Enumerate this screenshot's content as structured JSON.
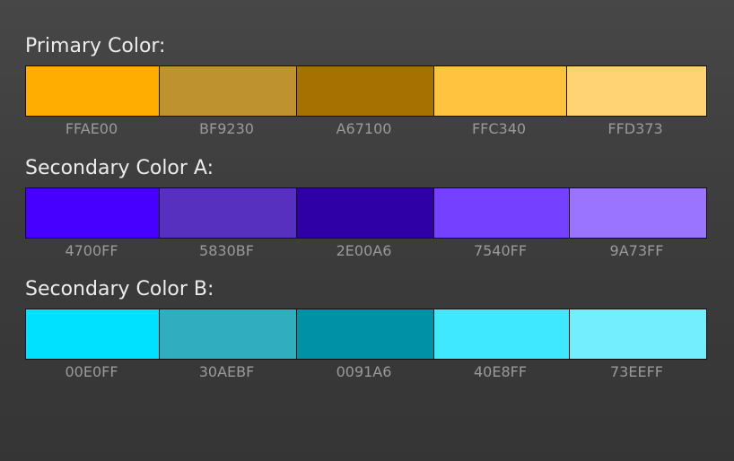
{
  "palettes": [
    {
      "title": "Primary Color:",
      "swatches": [
        {
          "hex": "#FFAE00",
          "code": "FFAE00"
        },
        {
          "hex": "#BF9230",
          "code": "BF9230"
        },
        {
          "hex": "#A67100",
          "code": "A67100"
        },
        {
          "hex": "#FFC340",
          "code": "FFC340"
        },
        {
          "hex": "#FFD373",
          "code": "FFD373"
        }
      ]
    },
    {
      "title": "Secondary Color A:",
      "swatches": [
        {
          "hex": "#4700FF",
          "code": "4700FF"
        },
        {
          "hex": "#5830BF",
          "code": "5830BF"
        },
        {
          "hex": "#2E00A6",
          "code": "2E00A6"
        },
        {
          "hex": "#7540FF",
          "code": "7540FF"
        },
        {
          "hex": "#9A73FF",
          "code": "9A73FF"
        }
      ]
    },
    {
      "title": "Secondary Color B:",
      "swatches": [
        {
          "hex": "#00E0FF",
          "code": "00E0FF"
        },
        {
          "hex": "#30AEBF",
          "code": "30AEBF"
        },
        {
          "hex": "#0091A6",
          "code": "0091A6"
        },
        {
          "hex": "#40E8FF",
          "code": "40E8FF"
        },
        {
          "hex": "#73EEFF",
          "code": "73EEFF"
        }
      ]
    }
  ]
}
